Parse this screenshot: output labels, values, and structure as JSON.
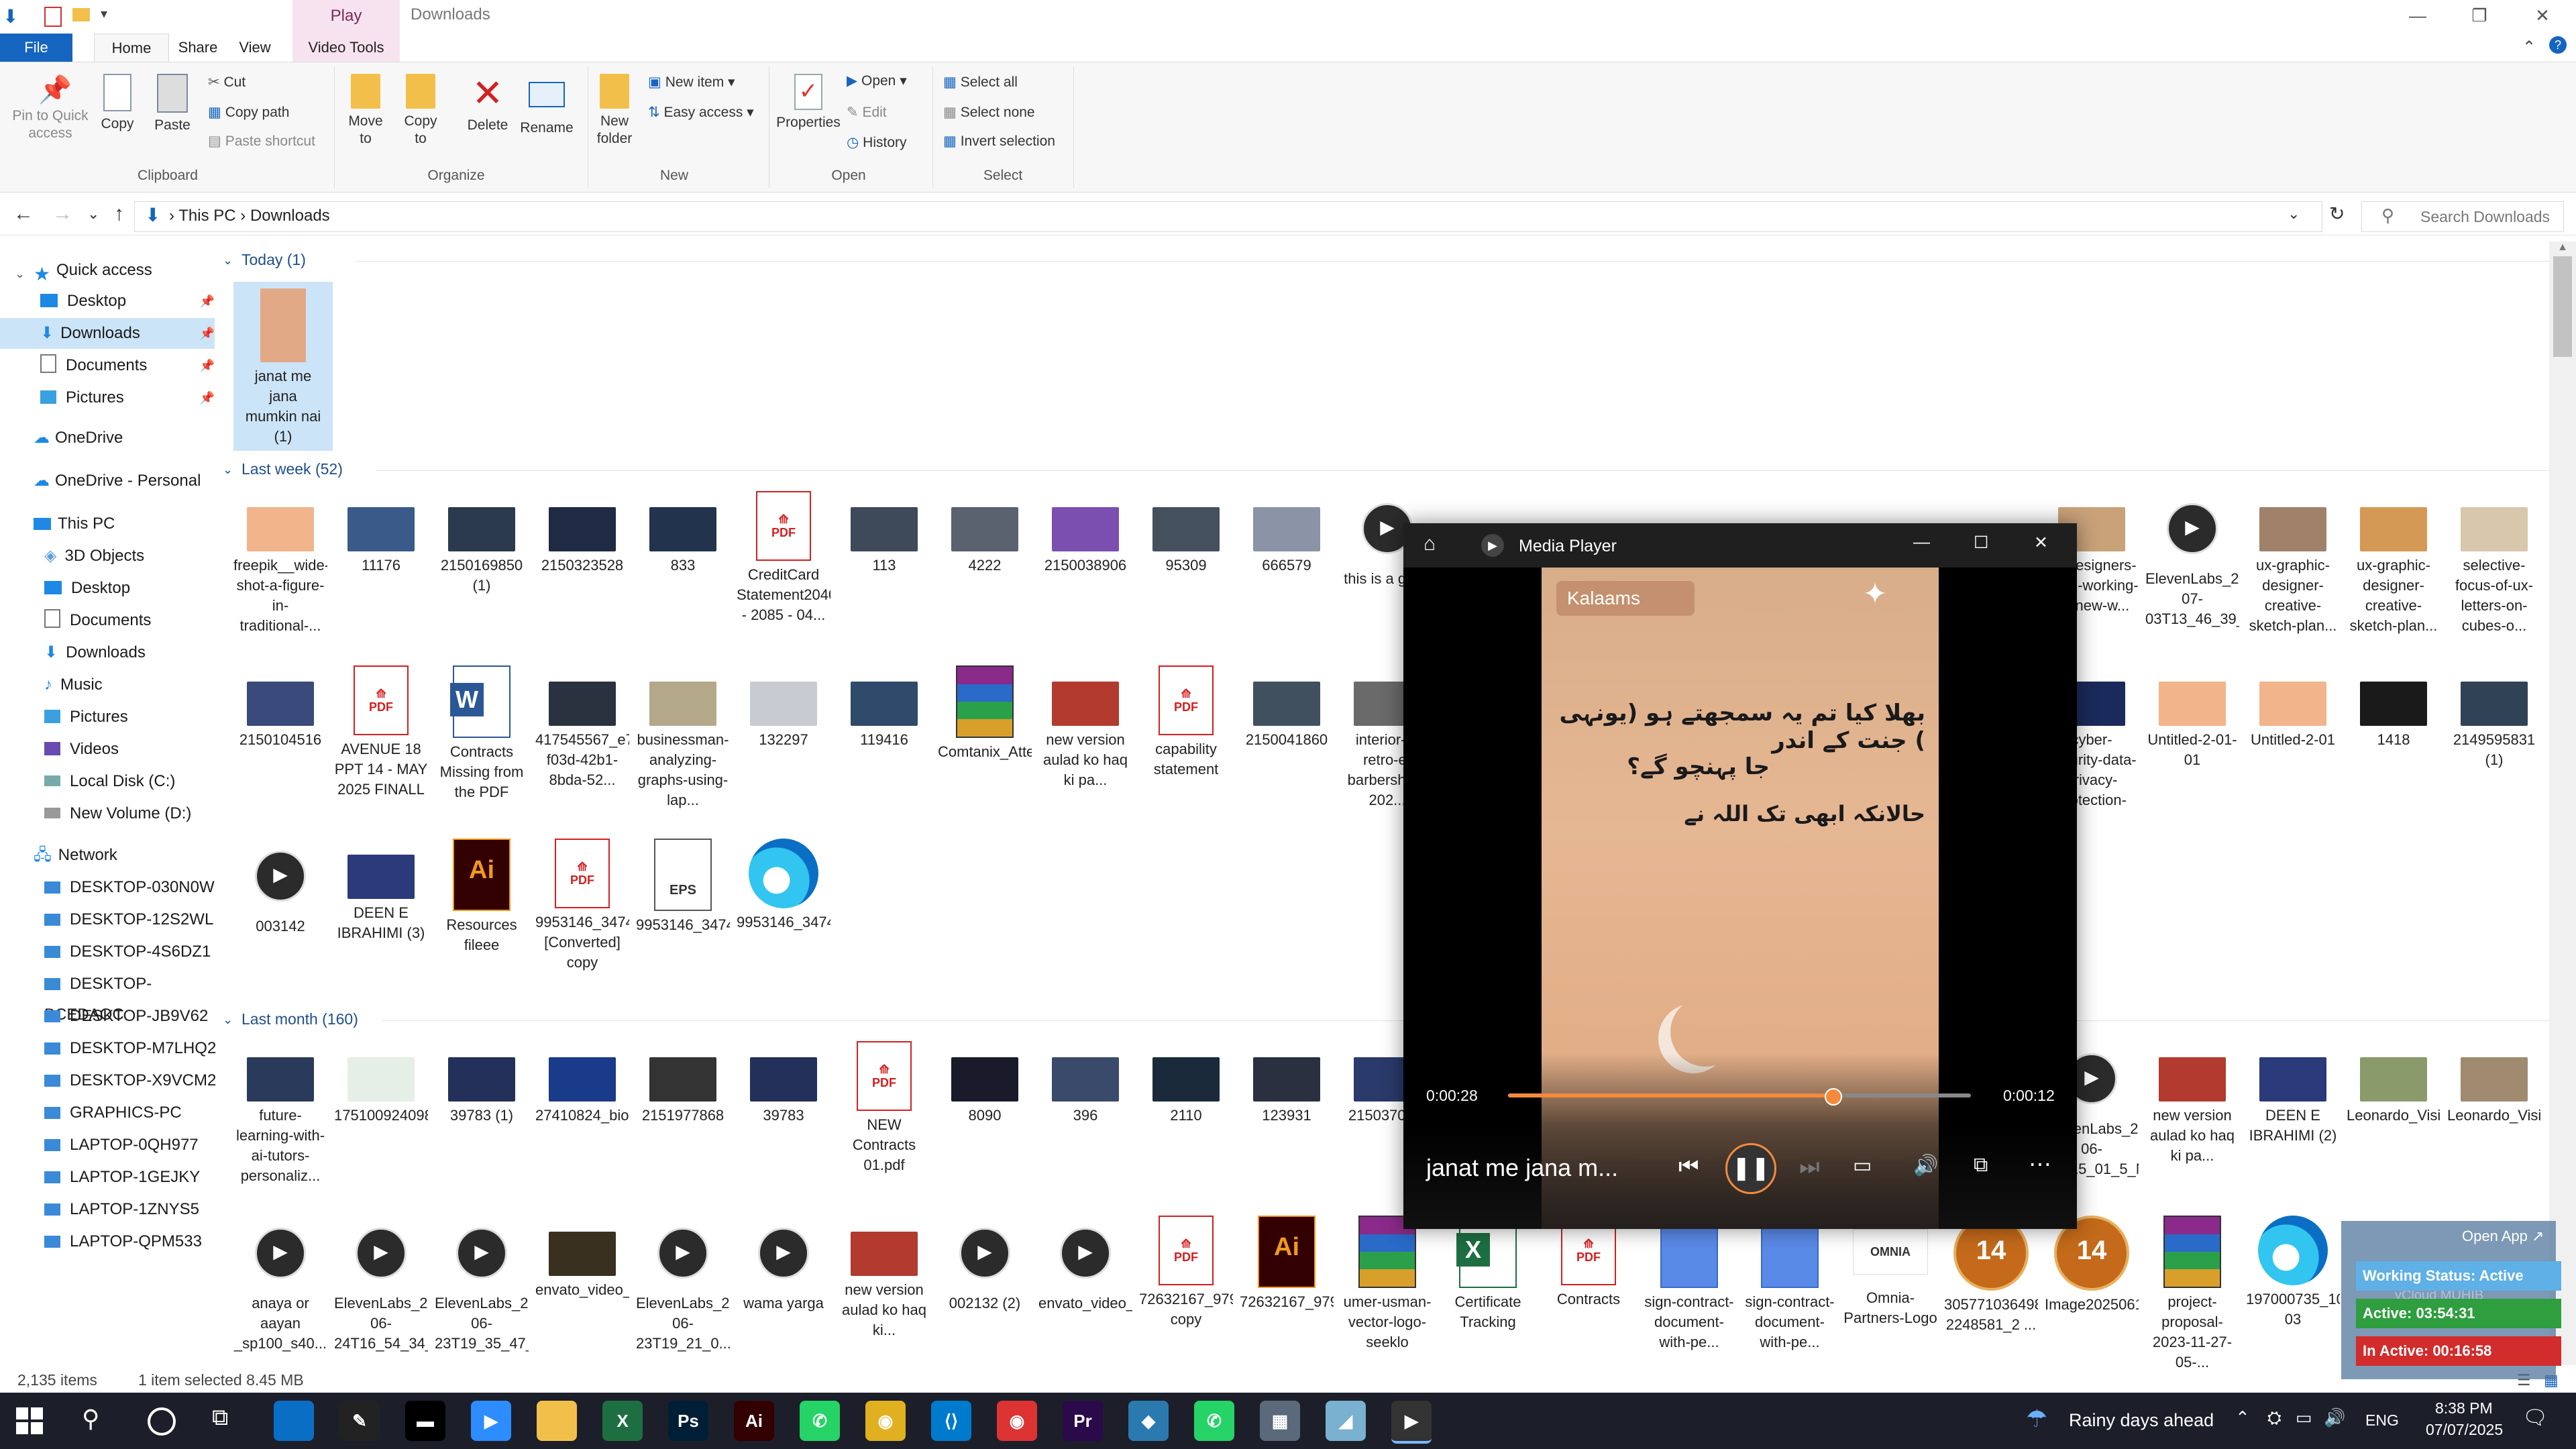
{
  "window": {
    "title": "Downloads",
    "context_tab": "Play"
  },
  "ribbon": {
    "tabs": [
      "File",
      "Home",
      "Share",
      "View",
      "Video Tools"
    ],
    "clipboard": {
      "pin": "Pin to Quick access",
      "copy": "Copy",
      "paste": "Paste",
      "cut": "Cut",
      "copy_path": "Copy path",
      "paste_shortcut": "Paste shortcut",
      "group": "Clipboard"
    },
    "organize": {
      "move": "Move to",
      "copy": "Copy to",
      "delete": "Delete",
      "rename": "Rename",
      "group": "Organize"
    },
    "new": {
      "new_folder": "New folder",
      "new_item": "New item",
      "easy_access": "Easy access",
      "group": "New"
    },
    "open": {
      "properties": "Properties",
      "open": "Open",
      "edit": "Edit",
      "history": "History",
      "group": "Open"
    },
    "select": {
      "all": "Select all",
      "none": "Select none",
      "invert": "Invert selection",
      "group": "Select"
    }
  },
  "address": {
    "crumbs": [
      "This PC",
      "Downloads"
    ],
    "search_placeholder": "Search Downloads"
  },
  "nav": {
    "quick_access": "Quick access",
    "quick": [
      "Desktop",
      "Downloads",
      "Documents",
      "Pictures"
    ],
    "onedrive": "OneDrive",
    "onedrive_personal": "OneDrive - Personal",
    "this_pc": "This PC",
    "pc": [
      "3D Objects",
      "Desktop",
      "Documents",
      "Downloads",
      "Music",
      "Pictures",
      "Videos",
      "Local Disk (C:)",
      "New Volume (D:)"
    ],
    "network": "Network",
    "net": [
      "DESKTOP-030N0W",
      "DESKTOP-12S2WL",
      "DESKTOP-4S6DZ1",
      "DESKTOP-BCEDAOC",
      "DESKTOP-JB9V62",
      "DESKTOP-M7LHQ2",
      "DESKTOP-X9VCM2",
      "GRAPHICS-PC",
      "LAPTOP-0QH977",
      "LAPTOP-1GEJKY",
      "LAPTOP-1ZNYS5",
      "LAPTOP-QPM533"
    ]
  },
  "groups": {
    "today": "Today (1)",
    "last_week": "Last week (52)",
    "last_month": "Last month (160)"
  },
  "files": {
    "today": [
      {
        "name": "janat me jana mumkin nai (1)",
        "color": "#e2a987"
      }
    ],
    "week_row1": [
      {
        "name": "freepik__wide-shot-a-figure-in-traditional-...",
        "color": "#f2b48a"
      },
      {
        "name": "11176",
        "color": "#3a5a8a"
      },
      {
        "name": "2150169850 (1)",
        "color": "#2b3a4e"
      },
      {
        "name": "2150323528",
        "color": "#1f2a44"
      },
      {
        "name": "833",
        "color": "#22334d"
      },
      {
        "name": "CreditCard Statement20408824 - 2085 - 04...",
        "color": "pdf"
      },
      {
        "name": "113",
        "color": "#3e4a5a"
      },
      {
        "name": "4222",
        "color": "#5a6270"
      },
      {
        "name": "2150038906",
        "color": "#7a4fb0"
      },
      {
        "name": "95309",
        "color": "#44505e"
      },
      {
        "name": "666579",
        "color": "#8a94a6"
      },
      {
        "name": "this is a good",
        "color": "media"
      }
    ],
    "week_row1_right": [
      {
        "name": "ux-designers-team-working-on-new-w...",
        "color": "#c9a27a"
      },
      {
        "name": "ElevenLabs_2025-07-03T13_46_39_Nassim...",
        "color": "media"
      },
      {
        "name": "ux-graphic-designer-creative-sketch-plan...",
        "color": "#a0826a"
      },
      {
        "name": "ux-graphic-designer-creative-sketch-plan...",
        "color": "#d49a55"
      },
      {
        "name": "selective-focus-of-ux-letters-on-cubes-o...",
        "color": "#d8c7ad"
      }
    ],
    "week_row2": [
      {
        "name": "2150104516",
        "color": "#3a4a7a"
      },
      {
        "name": "AVENUE 18 PPT 14 - MAY 2025 FINALL",
        "color": "pdf"
      },
      {
        "name": "Contracts Missing from the PDF",
        "color": "word"
      },
      {
        "name": "417545567_e755599e-f03d-42b1-8bda-52...",
        "color": "#2a3240"
      },
      {
        "name": "businessman-analyzing-graphs-using-lap...",
        "color": "#b4a88a"
      },
      {
        "name": "132297",
        "color": "#c8ccd2"
      },
      {
        "name": "119416",
        "color": "#2f4a6a"
      },
      {
        "name": "Comtanix_Attendance_Setup",
        "color": "rar"
      },
      {
        "name": "new version aulad ko haq ki pa...",
        "color": "#b33a2e"
      },
      {
        "name": "capability statement",
        "color": "pdf"
      },
      {
        "name": "2150041860",
        "color": "#40505e"
      },
      {
        "name": "interior-a-retro-e-barbershop-202...",
        "color": "#6a6a6a"
      }
    ],
    "week_row2_right": [
      {
        "name": "cyber-security-data-privacy-protection-con...",
        "color": "#1a2a5a"
      },
      {
        "name": "Untitled-2-01-01",
        "color": "#f2b48a"
      },
      {
        "name": "Untitled-2-01",
        "color": "#f2b48a"
      },
      {
        "name": "1418",
        "color": "#1a1a1a"
      },
      {
        "name": "2149595831 (1)",
        "color": "#2f4256"
      }
    ],
    "week_row3": [
      {
        "name": "003142",
        "color": "media"
      },
      {
        "name": "DEEN E IBRAHIMI (3)",
        "color": "#2a3a7a"
      },
      {
        "name": "Resources fileee",
        "color": "ai"
      },
      {
        "name": "9953146_3474 [Converted] copy",
        "color": "pdf"
      },
      {
        "name": "9953146_3474",
        "color": "eps"
      },
      {
        "name": "9953146_3474",
        "color": "edge"
      }
    ],
    "month_row1": [
      {
        "name": "future-learning-with-ai-tutors-personaliz...",
        "color": "#2a3a5a"
      },
      {
        "name": "1751009240982",
        "color": "#e6efe6"
      },
      {
        "name": "39783 (1)",
        "color": "#23305a"
      },
      {
        "name": "27410824_biotechnology_dna_26",
        "color": "#1a3a8a"
      },
      {
        "name": "2151977868",
        "color": "#333"
      },
      {
        "name": "39783",
        "color": "#23305a"
      },
      {
        "name": "NEW Contracts 01.pdf",
        "color": "pdf"
      },
      {
        "name": "8090",
        "color": "#1a1a2a"
      },
      {
        "name": "396",
        "color": "#3a4a6a"
      },
      {
        "name": "2110",
        "color": "#1a2a3a"
      },
      {
        "name": "123931",
        "color": "#2a3040"
      },
      {
        "name": "2150370...2",
        "color": "#2a3a6a"
      }
    ],
    "month_row1_right": [
      {
        "name": "ElevenLabs_2025-06-25T15_01_5_Nassim...",
        "color": "media"
      },
      {
        "name": "new version aulad ko haq ki pa...",
        "color": "#b33a2e"
      },
      {
        "name": "DEEN E IBRAHIMI (2)",
        "color": "#2a3a7a"
      },
      {
        "name": "Leonardo_Vision_XL_A_cheerful_young_bo...",
        "color": "#8a9a6a"
      },
      {
        "name": "Leonardo_Vision_XL_A_sweet_little_girl_n...",
        "color": "#a08a70"
      }
    ],
    "month_row2": [
      {
        "name": "anaya or aayan _sp100_s40...",
        "color": "media"
      },
      {
        "name": "ElevenLabs_2025-06-24T16_54_34_Nassim...",
        "color": "media"
      },
      {
        "name": "ElevenLabs_2025-06-23T19_35_47_Nassim...",
        "color": "media"
      },
      {
        "name": "envato_video_gen_Jun_23_2025_19_33_48...",
        "color": "#3a3020"
      },
      {
        "name": "ElevenLabs_2025-06-23T19_21_0...",
        "color": "media"
      },
      {
        "name": "wama yarga",
        "color": "media"
      },
      {
        "name": "new version aulad ko haq ki...",
        "color": "#b33a2e"
      },
      {
        "name": "002132 (2)",
        "color": "media"
      },
      {
        "name": "envato_video_gen_david_Jun_23_2025_14_3...",
        "color": "media"
      },
      {
        "name": "72632167_9796306 copy",
        "color": "pdf"
      },
      {
        "name": "72632167_9796306",
        "color": "ai"
      },
      {
        "name": "umer-usman-vector-logo-seeklo",
        "color": "rar"
      },
      {
        "name": "Certificate Tracking",
        "color": "excel"
      },
      {
        "name": "Contracts",
        "color": "pdf"
      },
      {
        "name": "sign-contract-document-with-pe...",
        "color": "doc"
      },
      {
        "name": "sign-contract-document-with-pe...",
        "color": "doc"
      },
      {
        "name": "Omnia-Partners-Logo",
        "color": "omnia"
      },
      {
        "name": "30577103649886937 2248581_2 ...",
        "color": "badge"
      },
      {
        "name": "Image20250619203407",
        "color": "badge"
      },
      {
        "name": "project-proposal-2023-11-27-05-...",
        "color": "rar"
      },
      {
        "name": "197000735_10777817-03",
        "color": "edge"
      }
    ]
  },
  "status": {
    "count": "2,135 items",
    "selected": "1 item selected  8.45 MB"
  },
  "player": {
    "app": "Media Player",
    "brand": "Kalaams",
    "urdu1": "بھلا کیا تم یہ سمجھتے ہو (یونہی ) جنت کے اندر",
    "urdu2": "جا پہنچو گے؟",
    "urdu3": "حالانکہ ابھی تک اللہ نے",
    "elapsed": "0:00:28",
    "remaining": "0:00:12",
    "progress": 0.7,
    "track": "janat me jana m..."
  },
  "popup": {
    "open_app": "Open App",
    "working": "Working Status: Active",
    "active": "Active: 03:54:31",
    "inactive": "In Active: 00:16:58",
    "bg_text": "vCloud MUHIB"
  },
  "taskbar": {
    "weather": "Rainy days ahead",
    "lang": "ENG",
    "time": "8:38 PM",
    "date": "07/07/2025"
  }
}
